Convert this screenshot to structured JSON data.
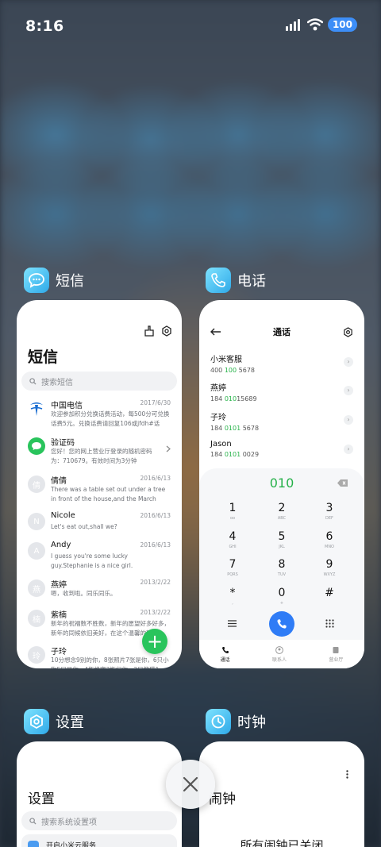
{
  "status_bar": {
    "time": "8:16",
    "battery": "100"
  },
  "apps": {
    "sms": {
      "header_label": "短信",
      "title": "短信",
      "search_placeholder": "搜索短信",
      "messages": [
        {
          "avatar": "",
          "name": "中国电信",
          "date": "2017/6/30",
          "preview": "欢迎参加积分兑换话费活动，每500分可兑换话费5元。兑换话费请回复106或jfdh#话费..."
        },
        {
          "avatar": "",
          "name": "验证码",
          "date": "",
          "preview": "您好！您的网上营业厅登录的随机密码为：710679。有效时间为3分钟"
        },
        {
          "avatar": "倩",
          "name": "倩倩",
          "date": "2016/6/13",
          "preview": "There was a table set out under a tree in front of the house,and the March Hare and..."
        },
        {
          "avatar": "N",
          "name": "Nicole",
          "date": "2016/6/13",
          "preview": "Let's eat out,shall we?"
        },
        {
          "avatar": "A",
          "name": "Andy",
          "date": "2016/6/13",
          "preview": "I guess you're some lucky guy.Stephanie is a nice girl."
        },
        {
          "avatar": "燕",
          "name": "燕婷",
          "date": "2013/2/22",
          "preview": "嗯，收到啦。同乐同乐。"
        },
        {
          "avatar": "楠",
          "name": "紫楠",
          "date": "2013/2/22",
          "preview": "新年的祝福数不胜数，新年的愿望好多好多，新年的同候依旧美好，在这个温馨的新年..."
        },
        {
          "avatar": "玲",
          "name": "子玲",
          "date": "",
          "preview": "10分想念9别的你，8张照片7张是你，6只小狗5只是你，4瓶蜂蜜3瓶归你，2只熊猫1..."
        }
      ],
      "fab_label": "+"
    },
    "phone": {
      "header_label": "电话",
      "title": "通话",
      "contacts": [
        {
          "name": "小米客服",
          "num_pre": "400 ",
          "num_hl": "100",
          "num_post": " 5678"
        },
        {
          "name": "燕婷",
          "num_pre": "184 ",
          "num_hl": "010",
          "num_post": "15689"
        },
        {
          "name": "子玲",
          "num_pre": "184 ",
          "num_hl": "0101",
          "num_post": " 5678"
        },
        {
          "name": "Jason",
          "num_pre": "184 ",
          "num_hl": "0101",
          "num_post": " 0029"
        }
      ],
      "dial_input": "010",
      "keys": [
        {
          "digit": "1",
          "letters": "oo"
        },
        {
          "digit": "2",
          "letters": "ABC"
        },
        {
          "digit": "3",
          "letters": "DEF"
        },
        {
          "digit": "4",
          "letters": "GHI"
        },
        {
          "digit": "5",
          "letters": "JKL"
        },
        {
          "digit": "6",
          "letters": "MNO"
        },
        {
          "digit": "7",
          "letters": "PQRS"
        },
        {
          "digit": "8",
          "letters": "TUV"
        },
        {
          "digit": "9",
          "letters": "WXYZ"
        },
        {
          "digit": "*",
          "letters": ","
        },
        {
          "digit": "0",
          "letters": "+"
        },
        {
          "digit": "#",
          "letters": ""
        }
      ],
      "tabs": [
        {
          "label": "通话"
        },
        {
          "label": "联系人"
        },
        {
          "label": "营业厅"
        }
      ]
    },
    "settings": {
      "header_label": "设置",
      "title": "设置",
      "search_placeholder": "搜索系统设置项",
      "first_item": "开启小米云服务"
    },
    "clock": {
      "header_label": "时钟",
      "title": "闹钟",
      "empty_text": "所有闹钟已关闭"
    }
  },
  "colors": {
    "accent_green": "#29c45c",
    "call_blue": "#2f7cf6",
    "battery_blue": "#3d8ef7"
  }
}
